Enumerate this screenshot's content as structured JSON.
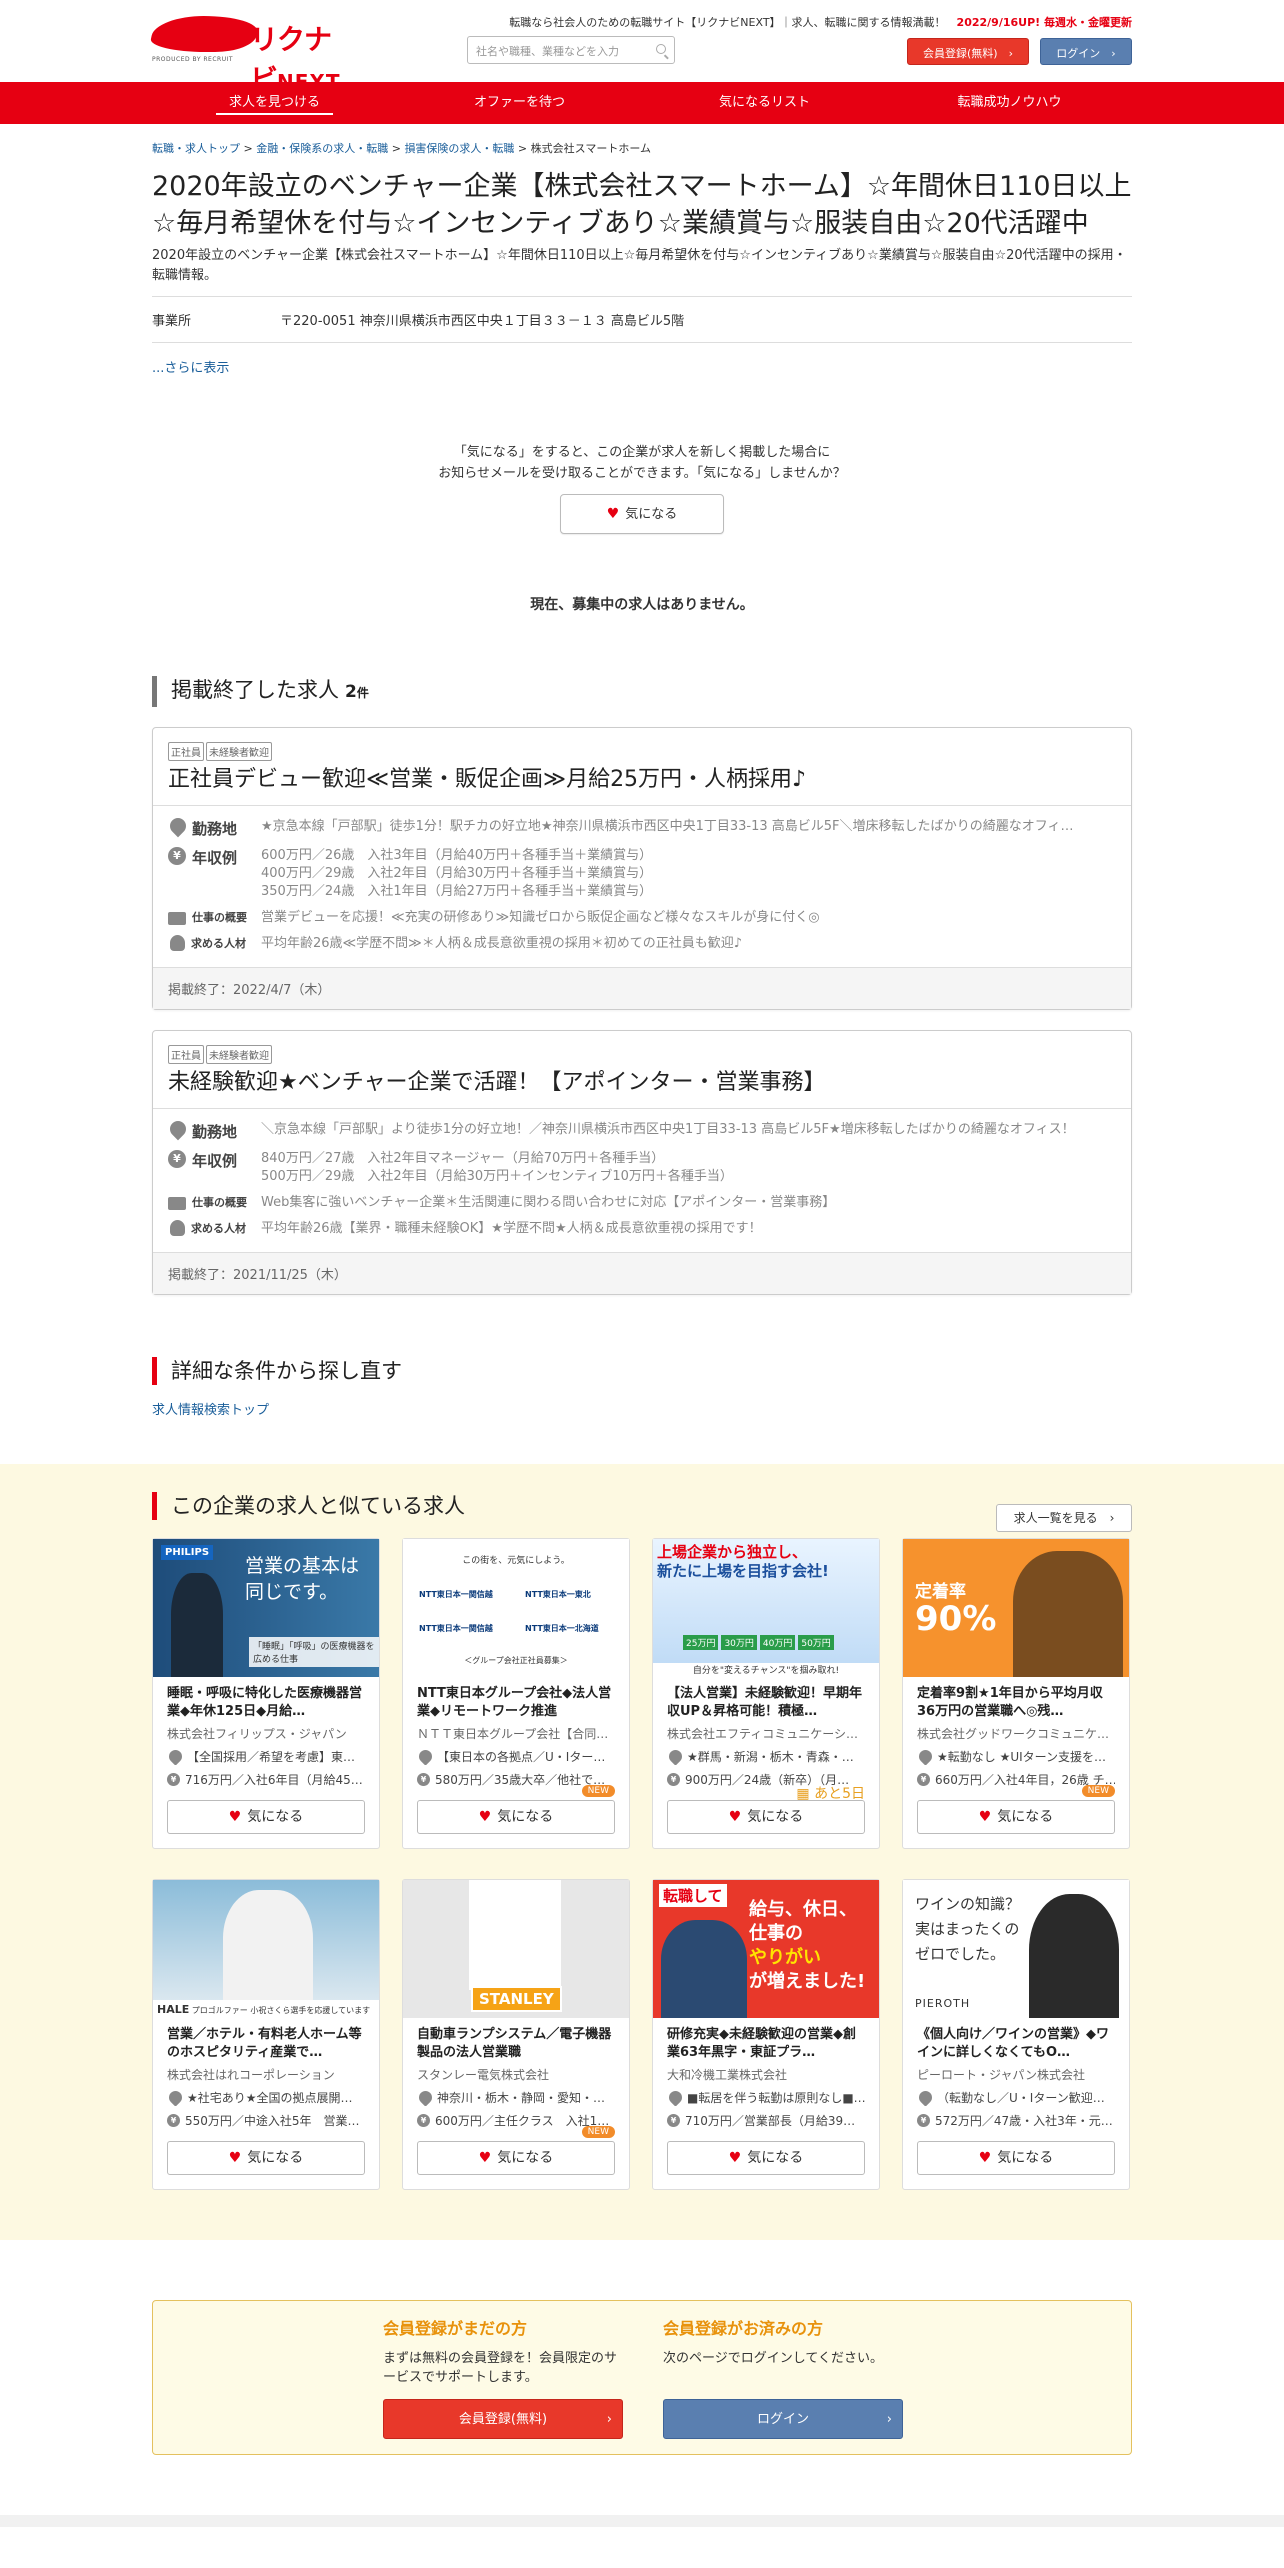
{
  "header": {
    "logo_text": "リクナビ",
    "logo_text2": "NEXT",
    "logo_sub": "PRODUCED BY RECRUIT",
    "tagline": "転職なら社会人のための転職サイト【リクナビNEXT】｜求人、転職に関する情報満載！",
    "update": "2022/9/16UP! 毎週水・金曜更新",
    "search_placeholder": "社名や職種、業種などを入力",
    "register_label": "会員登録(無料)",
    "login_label": "ログイン"
  },
  "nav": [
    "求人を見つける",
    "オファーを待つ",
    "気になるリスト",
    "転職成功ノウハウ"
  ],
  "breadcrumb": [
    "転職・求人トップ",
    "金融・保険系の求人・転職",
    "損害保険の求人・転職",
    "株式会社スマートホーム"
  ],
  "company": {
    "title": "2020年設立のベンチャー企業【株式会社スマートホーム】☆年間休日110日以上☆毎月希望休を付与☆インセンティブあり☆業績賞与☆服装自由☆20代活躍中",
    "subdesc": "2020年設立のベンチャー企業【株式会社スマートホーム】☆年間休日110日以上☆毎月希望休を付与☆インセンティブあり☆業績賞与☆服装自由☆20代活躍中の採用・転職情報。",
    "office_label": "事業所",
    "office_value": "〒220-0051 神奈川県横浜市西区中央１丁目３３－１３ 高島ビル5階",
    "more": "...さらに表示"
  },
  "fav": {
    "line1": "「気になる」をすると、この企業が求人を新しく掲載した場合に",
    "line2": "お知らせメールを受け取ることができます。「気になる」しませんか？",
    "button": "気になる"
  },
  "no_job": "現在、募集中の求人はありません。",
  "ended": {
    "heading": "掲載終了した求人",
    "count": "2",
    "unit": "件",
    "jobs": [
      {
        "tag1": "正社員",
        "tag2": "未経験者歓迎",
        "title": "正社員デビュー歓迎≪営業・販促企画≫月給25万円・人柄採用♪",
        "loc_label": "勤務地",
        "loc": "★京急本線「戸部駅」徒歩1分！駅チカの好立地★神奈川県横浜市西区中央1丁目33-13 高島ビル5F＼増床移転したばかりの綺麗なオフィ…",
        "pay_label": "年収例",
        "pay1": "600万円／26歳　入社3年目（月給40万円＋各種手当＋業績賞与）",
        "pay2": "400万円／29歳　入社2年目（月給30万円＋各種手当＋業績賞与）",
        "pay3": "350万円／24歳　入社1年目（月給27万円＋各種手当＋業績賞与）",
        "work_label": "仕事の概要",
        "work": "営業デビューを応援！≪充実の研修あり≫知識ゼロから販促企画など様々なスキルが身に付く◎",
        "req_label": "求める人材",
        "req": "平均年齢26歳≪学歴不問≫＊人柄＆成長意欲重視の採用＊初めての正社員も歓迎♪",
        "ended": "掲載終了：2022/4/7（木）"
      },
      {
        "tag1": "正社員",
        "tag2": "未経験者歓迎",
        "title": "未経験歓迎★ベンチャー企業で活躍！【アポインター・営業事務】",
        "loc_label": "勤務地",
        "loc": "＼京急本線「戸部駅」より徒歩1分の好立地！／神奈川県横浜市西区中央1丁目33-13 高島ビル5F★増床移転したばかりの綺麗なオフィス！",
        "pay_label": "年収例",
        "pay1": "840万円／27歳　入社2年目マネージャー（月給70万円＋各種手当）",
        "pay2": "500万円／29歳　入社2年目（月給30万円＋インセンティブ10万円＋各種手当）",
        "pay3": "",
        "work_label": "仕事の概要",
        "work": "Web集客に強いベンチャー企業＊生活関連に関わる問い合わせに対応【アポインター・営業事務】",
        "req_label": "求める人材",
        "req": "平均年齢26歳【業界・職種未経験OK】★学歴不問★人柄＆成長意欲重視の採用です！",
        "ended": "掲載終了：2021/11/25（木）"
      }
    ]
  },
  "research": {
    "heading": "詳細な条件から探し直す",
    "link": "求人情報検索トップ"
  },
  "similar": {
    "heading": "この企業の求人と似ている求人",
    "list_button": "求人一覧を見る",
    "fav_label": "気になる",
    "img_texts": {
      "philips_logo": "PHILIPS",
      "philips_t1": "営業の基本は",
      "philips_t1b": "同じです。",
      "philips_t2": "「睡眠」「呼吸」の医療機器を広める仕事",
      "ntt_t": "この街を、元気にしよう。",
      "ntt_b1": "NTT東日本一関信越",
      "ntt_b2": "NTT東日本一東北",
      "ntt_b3": "NTT東日本一関信越",
      "ntt_b4": "NTT東日本一北海道",
      "ntt_foot": "＜グループ会社正社員募集＞",
      "ef_t1": "上場企業から",
      "ef_t1a": "独立",
      "ef_t1b": "し、",
      "ef_t2": "新たに上場を目指す会社!",
      "ef_nums": [
        "25万円",
        "30万円",
        "40万円",
        "50万円"
      ],
      "ef_bar": "自分を\"変えるチャンス\"を掴み取れ!",
      "good_t1": "定着率",
      "good_t2": "90%",
      "hale_logo": "HALE",
      "hale_sub": "プロゴルファー 小祝さくら選手を応援しています",
      "stanley_logo": "STANLEY",
      "daiwa_t": "転職して",
      "daiwa_t2a": "給与、休日、",
      "daiwa_t2b": "仕事の",
      "daiwa_t2c": "やりがい",
      "daiwa_t2d": "が増えました!",
      "pier_t1": "ワインの知識？",
      "pier_t2": "実はまったくの",
      "pier_t3": "ゼロでした。",
      "pier_logo": "PIEROTH"
    },
    "items": [
      {
        "title": "睡眠・呼吸に特化した医療機器営業◆年休125日◆月給…",
        "company": "株式会社フィリップス・ジャパン",
        "loc": "【全国採用／希望を考慮】東…",
        "pay": "716万円／入社6年目（月給45…",
        "badge": ""
      },
      {
        "title": "NTT東日本グループ会社◆法人営業◆リモートワーク推進",
        "company": "ＮＴＴ東日本グループ会社【合同…",
        "loc": "【東日本の各拠点／U・Iター…",
        "pay": "580万円／35歳大卒／他社で…",
        "badge": "NEW"
      },
      {
        "title": "【法人営業】未経験歓迎！早期年収UP＆昇格可能！積極…",
        "company": "株式会社エフティコミュニケーシ…",
        "loc": "★群馬・新潟・栃木・青森・…",
        "pay": "900万円／24歳（新卒）（月…",
        "badge": "あと5日"
      },
      {
        "title": "定着率9割★1年目から平均月収36万円の営業職へ◎残…",
        "company": "株式会社グッドワークコミュニケ…",
        "loc": "★転勤なし ★UIターン支援を…",
        "pay": "660万円／入社4年目，26歳 チ…",
        "badge": "NEW"
      },
      {
        "title": "営業／ホテル・有料老人ホーム等のホスピタリティ産業で…",
        "company": "株式会社はれコーポレーション",
        "loc": "★社宅あり★全国の拠点展開…",
        "pay": "550万円／中途入社5年　営業…",
        "badge": ""
      },
      {
        "title": "自動車ランプシステム／電子機器製品の法人営業職",
        "company": "スタンレー電気株式会社",
        "loc": "神奈川・栃木・静岡・愛知・…",
        "pay": "600万円／主任クラス　入社1…",
        "badge": "NEW"
      },
      {
        "title": "研修充実◆未経験歓迎の営業◆創業63年黒字・東証プラ…",
        "company": "大和冷機工業株式会社",
        "loc": "■転居を伴う転勤は原則なし■…",
        "pay": "710万円／営業部長（月給39…",
        "badge": ""
      },
      {
        "title": "《個人向け／ワインの営業》◆ワインに詳しくなくてもO…",
        "company": "ピーロート・ジャパン株式会社",
        "loc": "（転勤なし／U・Iターン歓迎…",
        "pay": "572万円／47歳・入社3年・元…",
        "badge": ""
      }
    ]
  },
  "bottom": {
    "left_title": "会員登録がまだの方",
    "left_text": "まずは無料の会員登録を！会員限定のサービスでサポートします。",
    "left_button": "会員登録(無料)",
    "right_title": "会員登録がお済みの方",
    "right_text": "次のページでログインしてください。",
    "right_button": "ログイン"
  },
  "colors": {
    "brand": "#e60012",
    "link": "#1a5e9a",
    "login": "#5a7fb0",
    "accent": "#e8920c"
  }
}
